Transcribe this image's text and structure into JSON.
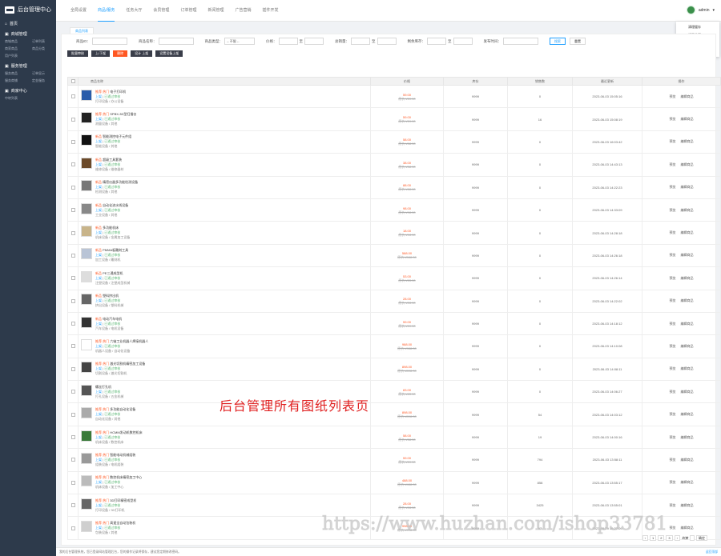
{
  "app": {
    "title": "后台管理中心"
  },
  "sidebar": {
    "home": "首页",
    "groups": [
      {
        "title": "商城管理",
        "items": [
          "商城商品",
          "订单列表",
          "商家商品",
          "商品分类",
          "用户列表"
        ]
      },
      {
        "title": "服务管理",
        "items": [
          "服务商品",
          "订单显示",
          "服务商铺",
          "定金服务"
        ]
      },
      {
        "title": "商家中心",
        "items": [
          "中转列表"
        ]
      }
    ]
  },
  "topnav": {
    "items": [
      "全局设置",
      "商品/服务",
      "任务大厅",
      "会员管理",
      "订单管理",
      "新闻管理",
      "广告营销",
      "插件开发"
    ],
    "active": 1
  },
  "user": {
    "name": "admin"
  },
  "dropdown": [
    "清理缓存",
    "返回首页",
    "修改密码",
    "退出"
  ],
  "tab": "商品列表",
  "filters": {
    "id_label": "商品ID：",
    "name_label": "商品名称：",
    "type_label": "商品类型：",
    "type_value": "-- 不限 --",
    "price_label": "价格：",
    "to": "至",
    "sales_label": "总销量：",
    "stock_label": "剩余库存：",
    "date_label": "发布时间：",
    "search": "搜索",
    "reset": "重置"
  },
  "actions": [
    "批量审核",
    "上/下架",
    "删除",
    "设计 上架",
    "设置设备上架"
  ],
  "table": {
    "headers": [
      "",
      "商品名称",
      "价格",
      "库存",
      "销售数",
      "最近更新",
      "操作"
    ],
    "rows": [
      {
        "tag": "推荐 热门",
        "title": "电子打印机",
        "status": "上架",
        "sub": "已通过审核",
        "cat": "打印设备 / 办公设备",
        "price": "59.00",
        "old": "原价:¥59.00",
        "stock": "9999",
        "sales": "0",
        "time": "2023-06-03 15:05:16",
        "thumb": "#2a5caa"
      },
      {
        "tag": "推荐 热门",
        "title": "SPBX-3D型扫描仪",
        "status": "上架",
        "sub": "已通过审核",
        "cat": "测量设备 / 其他",
        "price": "59.00",
        "old": "原价:¥59.00",
        "stock": "9999",
        "sales": "16",
        "time": "2023-06-03 15:08:19",
        "thumb": "#222"
      },
      {
        "tag": "新品",
        "title": "智能测控电子元件组",
        "status": "上架",
        "sub": "已通过审核",
        "cat": "智能设备 / 其他",
        "price": "58.00",
        "old": "原价:¥58.00",
        "stock": "9999",
        "sales": "0",
        "time": "2023-06-03 16:03:42",
        "thumb": "#111"
      },
      {
        "tag": "新品",
        "title": "超级工具套装",
        "status": "上架",
        "sub": "已通过审核",
        "cat": "维修设备 / 维修器材",
        "price": "38.00",
        "old": "原价:¥38.00",
        "stock": "9999",
        "sales": "0",
        "time": "2023-06-03 14:43:13",
        "thumb": "#6b4a2a"
      },
      {
        "tag": "新品",
        "title": "精密仪器多功能检测设备",
        "status": "上架",
        "sub": "已通过审核",
        "cat": "检测设备 / 其他",
        "price": "88.00",
        "old": "原价:¥88.00",
        "stock": "9999",
        "sales": "0",
        "time": "2023-06-03 14:22:23",
        "thumb": "#777"
      },
      {
        "tag": "新品",
        "title": "自动化流水线设备",
        "status": "上架",
        "sub": "已通过审核",
        "cat": "工业设备 / 其他",
        "price": "98.00",
        "old": "原价:¥98.00",
        "stock": "9999",
        "sales": "0",
        "time": "2023-06-03 14:33:09",
        "thumb": "#888"
      },
      {
        "tag": "新品",
        "title": "多功能机床",
        "status": "上架",
        "sub": "已通过审核",
        "cat": "机床设备 / 金属加工设备",
        "price": "18.00",
        "old": "原价:¥18.00",
        "stock": "9999",
        "sales": "0",
        "time": "2023-06-03 14:28:18",
        "thumb": "#c8b48a"
      },
      {
        "tag": "新品",
        "title": "PMMA板雕刻工具",
        "status": "上架",
        "sub": "已通过审核",
        "cat": "加工设备 / 雕刻机",
        "price": "588.00",
        "old": "原价:¥588.00",
        "stock": "9999",
        "sales": "0",
        "time": "2023-06-03 14:26:18",
        "thumb": "#b9c4d6"
      },
      {
        "tag": "新品",
        "title": "PE三通成型机",
        "status": "上架",
        "sub": "已通过审核",
        "cat": "注塑设备 / 注塑成型机械",
        "price": "53.00",
        "old": "原价:¥53.00",
        "stock": "9999",
        "sales": "0",
        "time": "2023-06-03 14:26:14",
        "thumb": "#ddd"
      },
      {
        "tag": "新品",
        "title": "塑料挤出机",
        "status": "上架",
        "sub": "已通过审核",
        "cat": "挤出设备 / 塑料机械",
        "price": "28.00",
        "old": "原价:¥28.00",
        "stock": "9999",
        "sales": "0",
        "time": "2023-06-03 14:22:02",
        "thumb": "#666"
      },
      {
        "tag": "新品",
        "title": "电动汽车电机",
        "status": "上架",
        "sub": "已通过审核",
        "cat": "汽车设备 / 电机设备",
        "price": "59.00",
        "old": "原价:¥59.00",
        "stock": "9999",
        "sales": "0",
        "time": "2023-06-03 14:18:12",
        "thumb": "#333"
      },
      {
        "tag": "推荐 热门",
        "title": "六轴工业机器人焊接机器人",
        "status": "上架",
        "sub": "已通过审核",
        "cat": "机器人设备 / 自动化设备",
        "price": "988.00",
        "old": "原价:¥988.00",
        "stock": "9999",
        "sales": "0",
        "time": "2023-06-03 14:10:08",
        "thumb": "#fff"
      },
      {
        "tag": "推荐 热门",
        "title": "激光切割机精密加工设备",
        "status": "上架",
        "sub": "已通过审核",
        "cat": "切割设备 / 激光切割机",
        "price": "898.00",
        "old": "原价:¥898.00",
        "stock": "9999",
        "sales": "0",
        "time": "2023-06-03 14:08:11",
        "thumb": "#444"
      },
      {
        "tag": "",
        "title": "螺丝打孔机",
        "status": "上架",
        "sub": "已通过审核",
        "cat": "打孔设备 / 五金机械",
        "price": "83.00",
        "old": "原价:¥83.00",
        "stock": "9999",
        "sales": "0",
        "time": "2023-06-03 14:06:27",
        "thumb": "#555"
      },
      {
        "tag": "推荐 热门",
        "title": "多功能自动化设备",
        "status": "上架",
        "sub": "已通过审核",
        "cat": "自动化设备 / 其他",
        "price": "898.00",
        "old": "原价:¥898.00",
        "stock": "9999",
        "sales": "54",
        "time": "2023-06-03 14:03:12",
        "thumb": "#aaa"
      },
      {
        "tag": "推荐 热门",
        "title": "HCMM发动机数控机床",
        "status": "上架",
        "sub": "已通过审核",
        "cat": "机床设备 / 数控机床",
        "price": "58.00",
        "old": "原价:¥58.00",
        "stock": "9999",
        "sales": "19",
        "time": "2023-06-03 14:00:16",
        "thumb": "#3a7a3a"
      },
      {
        "tag": "推荐 热门",
        "title": "智能电动机械组装",
        "status": "上架",
        "sub": "已通过审核",
        "cat": "组装设备 / 电机组装",
        "price": "59.00",
        "old": "原价:¥59.00",
        "stock": "9999",
        "sales": "794",
        "time": "2023-06-03 13:58:11",
        "thumb": "#999"
      },
      {
        "tag": "推荐 热门",
        "title": "数控机床精密加工中心",
        "status": "上架",
        "sub": "已通过审核",
        "cat": "机床设备 / 加工中心",
        "price": "488.00",
        "old": "原价:¥488.00",
        "stock": "9999",
        "sales": "858",
        "time": "2023-06-03 13:55:17",
        "thumb": "#bbb"
      },
      {
        "tag": "推荐 热门",
        "title": "3D打印精密成型机",
        "status": "上架",
        "sub": "已通过审核",
        "cat": "打印设备 / 3D打印机",
        "price": "28.00",
        "old": "原价:¥28.00",
        "stock": "9999",
        "sales": "3425",
        "time": "2023-06-03 13:55:01",
        "thumb": "#666"
      },
      {
        "tag": "推荐 热门",
        "title": "高速全自动包装机",
        "status": "上架",
        "sub": "已通过审核",
        "cat": "包装设备 / 其他",
        "price": "998.00",
        "old": "原价:¥998.00",
        "stock": "9999",
        "sales": "97",
        "time": "2023-05-29 16:27:09",
        "thumb": "#cfcfcf"
      }
    ],
    "ops": [
      "预览",
      "编辑商品"
    ]
  },
  "watermark": "后台管理所有图纸列表页",
  "url_watermark": "https://www.huzhan.com/ishop33781",
  "pager": {
    "pages": [
      "1",
      "2",
      "3"
    ],
    "goto": "到第",
    "confirm": "确定"
  },
  "footer": {
    "text": "我的后台管理系统，您已登录网站管理后台，您的操作记录将保存，建议您定期修改密码。",
    "right": "返回顶部"
  }
}
